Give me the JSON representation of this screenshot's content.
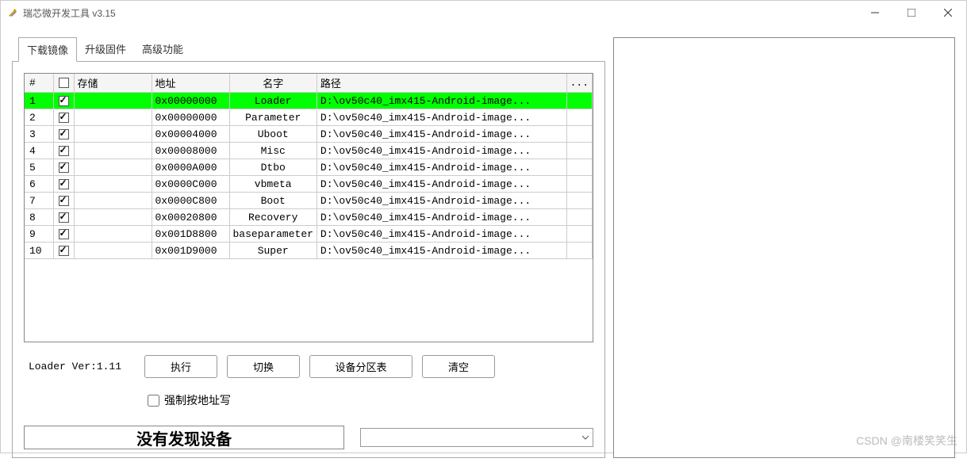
{
  "window": {
    "title": "瑞芯微开发工具 v3.15"
  },
  "tabs": [
    {
      "label": "下载镜像",
      "active": true
    },
    {
      "label": "升级固件",
      "active": false
    },
    {
      "label": "高级功能",
      "active": false
    }
  ],
  "table": {
    "headers": {
      "idx": "#",
      "chk": "",
      "storage": "存储",
      "addr": "地址",
      "name": "名字",
      "path": "路径",
      "btn": "..."
    },
    "rows": [
      {
        "idx": "1",
        "checked": true,
        "selected": true,
        "storage": "",
        "addr": "0x00000000",
        "name": "Loader",
        "path": "D:\\ov50c40_imx415-Android-image..."
      },
      {
        "idx": "2",
        "checked": true,
        "selected": false,
        "storage": "",
        "addr": "0x00000000",
        "name": "Parameter",
        "path": "D:\\ov50c40_imx415-Android-image..."
      },
      {
        "idx": "3",
        "checked": true,
        "selected": false,
        "storage": "",
        "addr": "0x00004000",
        "name": "Uboot",
        "path": "D:\\ov50c40_imx415-Android-image..."
      },
      {
        "idx": "4",
        "checked": true,
        "selected": false,
        "storage": "",
        "addr": "0x00008000",
        "name": "Misc",
        "path": "D:\\ov50c40_imx415-Android-image..."
      },
      {
        "idx": "5",
        "checked": true,
        "selected": false,
        "storage": "",
        "addr": "0x0000A000",
        "name": "Dtbo",
        "path": "D:\\ov50c40_imx415-Android-image..."
      },
      {
        "idx": "6",
        "checked": true,
        "selected": false,
        "storage": "",
        "addr": "0x0000C000",
        "name": "vbmeta",
        "path": "D:\\ov50c40_imx415-Android-image..."
      },
      {
        "idx": "7",
        "checked": true,
        "selected": false,
        "storage": "",
        "addr": "0x0000C800",
        "name": "Boot",
        "path": "D:\\ov50c40_imx415-Android-image..."
      },
      {
        "idx": "8",
        "checked": true,
        "selected": false,
        "storage": "",
        "addr": "0x00020800",
        "name": "Recovery",
        "path": "D:\\ov50c40_imx415-Android-image..."
      },
      {
        "idx": "9",
        "checked": true,
        "selected": false,
        "storage": "",
        "addr": "0x001D8800",
        "name": "baseparameter",
        "path": "D:\\ov50c40_imx415-Android-image..."
      },
      {
        "idx": "10",
        "checked": true,
        "selected": false,
        "storage": "",
        "addr": "0x001D9000",
        "name": "Super",
        "path": "D:\\ov50c40_imx415-Android-image..."
      }
    ]
  },
  "footer": {
    "loader_ver": "Loader Ver:1.11",
    "btn_execute": "执行",
    "btn_switch": "切换",
    "btn_partition": "设备分区表",
    "btn_clear": "清空",
    "force_write_label": "强制按地址写",
    "device_status": "没有发现设备"
  },
  "watermark": "CSDN @南楼笑笑生"
}
